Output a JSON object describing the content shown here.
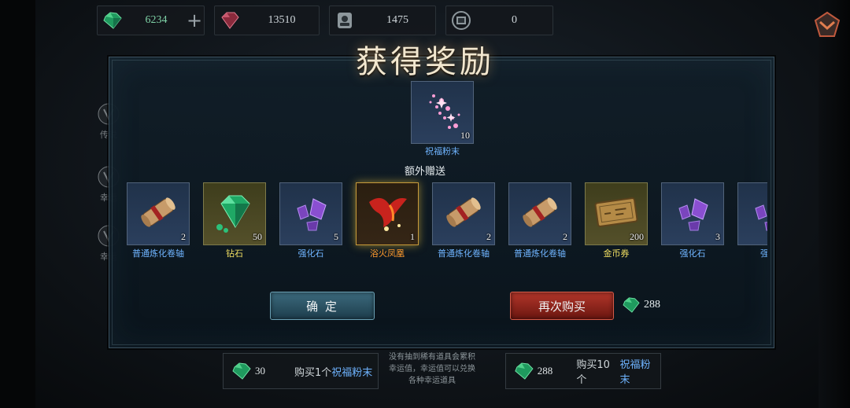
{
  "currencies": [
    {
      "icon": "green-gem-icon",
      "value": "6234",
      "has_plus": true
    },
    {
      "icon": "red-gem-icon",
      "value": "13510"
    },
    {
      "icon": "medal-icon",
      "value": "1475"
    },
    {
      "icon": "ticket-icon",
      "value": "0"
    }
  ],
  "plus_label": "+",
  "side_menu": [
    "传说",
    "幸运",
    "幸运"
  ],
  "dialog": {
    "title": "获得奖励",
    "main_reward": {
      "name": "祝福粉末",
      "qty": "10",
      "icon": "pink-sparkle-powder-icon"
    },
    "extra_label": "额外赠送",
    "items": [
      {
        "name": "普通炼化卷轴",
        "qty": "2",
        "icon": "scroll-icon",
        "rarity": "blue"
      },
      {
        "name": "钻石",
        "qty": "50",
        "icon": "green-diamond-icon",
        "rarity": "gold"
      },
      {
        "name": "强化石",
        "qty": "5",
        "icon": "purple-crystal-icon",
        "rarity": "blue"
      },
      {
        "name": "浴火凤凰",
        "qty": "1",
        "icon": "phoenix-icon",
        "rarity": "orange"
      },
      {
        "name": "普通炼化卷轴",
        "qty": "2",
        "icon": "scroll-icon",
        "rarity": "blue"
      },
      {
        "name": "普通炼化卷轴",
        "qty": "2",
        "icon": "scroll-icon",
        "rarity": "blue"
      },
      {
        "name": "金币券",
        "qty": "200",
        "icon": "gold-coupon-icon",
        "rarity": "gold"
      },
      {
        "name": "强化石",
        "qty": "3",
        "icon": "purple-crystal-icon",
        "rarity": "blue"
      },
      {
        "name": "强化",
        "qty": "",
        "icon": "purple-crystal-icon",
        "rarity": "blue"
      }
    ],
    "confirm_label": "确 定",
    "rebuy_label": "再次购买",
    "rebuy_cost": "288"
  },
  "bottom": {
    "buy1": {
      "price": "30",
      "text": "购买1个",
      "item": "祝福粉末"
    },
    "buy10": {
      "price": "288",
      "text": "购买10个",
      "item": "祝福粉末"
    },
    "note": "没有抽到稀有道具会累积幸运值，幸运值可以兑换各种幸运道具"
  },
  "colors": {
    "blue_name": "#6fb4ff",
    "gold_name": "#f1df62",
    "orange_name": "#ff9b2e",
    "rebuy_button": "#b3362a",
    "confirm_button": "#3c6a7d"
  }
}
